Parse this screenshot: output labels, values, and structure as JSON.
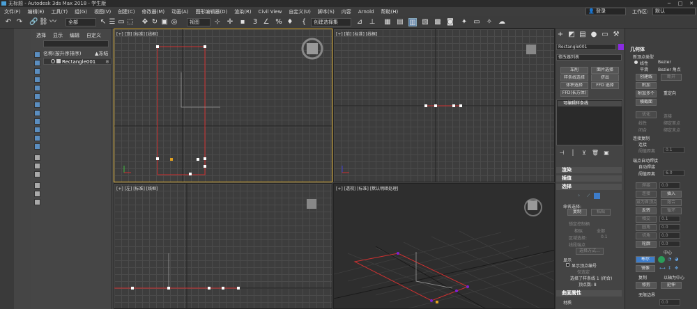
{
  "titlebar": {
    "title": "无标题 - Autodesk 3ds Max 2018 - 学生版"
  },
  "menu": [
    "文件(F)",
    "编辑(E)",
    "工具(T)",
    "组(G)",
    "视图(V)",
    "创建(C)",
    "修改器(M)",
    "动画(A)",
    "图形编辑器(D)",
    "渲染(R)",
    "Civil View",
    "自定义(U)",
    "脚本(S)",
    "内容",
    "Arnold",
    "帮助(H)"
  ],
  "login": "登录",
  "workspace": {
    "label": "工作区:",
    "value": "默认"
  },
  "toolbar": {
    "filter": "全部",
    "refcoord": "视图",
    "selset": "创建选择集"
  },
  "scene": {
    "tabs": [
      "选择",
      "显示",
      "编辑",
      "自定义"
    ],
    "col_name": "名称(按升序排序)",
    "col_freeze": "▲冻结",
    "object": "Rectangle001"
  },
  "viewports": {
    "top": "[+] [顶] [标准] [线框]",
    "front": "[+] [前] [标准] [线框]",
    "left": "[+] [左] [标准] [线框]",
    "persp": "[+] [透视] [标准] [默认明暗处理]"
  },
  "cmd": {
    "objname": "Rectangle001",
    "modlist": "修改器列表",
    "btns": [
      "车削",
      "面片选择",
      "样条线选择",
      "挤出",
      "体积选择",
      "FFD 选择",
      "FFD(长方体)"
    ],
    "stack": "可编辑样条线",
    "sections": [
      "渲染",
      "插值",
      "选择"
    ],
    "named_sel": "命名选择:",
    "copy": "复制",
    "paste": "粘贴",
    "lock_handles": "锁定控制柄",
    "similar": "相似",
    "all": "全部",
    "area_sel": "区域选择:",
    "area_val": "0.1",
    "seg_end": "线段端点",
    "sel_by": "选择方式...",
    "display": "显示",
    "show_vnum": "显示顶点编号",
    "sel_only": "仅选定",
    "status": "选择了样条线 1 (闭合)",
    "vcount": "顶点数: 8",
    "surface": "曲面属性",
    "material": "材质"
  },
  "rollout": {
    "title": "几何体",
    "newvtype": "新顶点类型",
    "types": [
      "线性",
      "Bezier",
      "平滑",
      "Bezier 角点"
    ],
    "create_line": "创建线",
    "break": "断开",
    "attach": "附加",
    "attach_multi": "附加多个",
    "reorient": "重定向",
    "cross_section": "横截面",
    "refine": "优化",
    "connect": "连接",
    "linear": "线性",
    "bind_first": "绑定首点",
    "closed": "闭合",
    "bind_last": "绑定末点",
    "connect_copy": "连接复制",
    "connect_opt": "连接",
    "threshold": "阈值距离",
    "th_val": "0.1",
    "end_weld": "端点自动焊接",
    "auto_weld": "自动焊接",
    "weld_th": "阈值距离",
    "weld_val": "6.0",
    "weld": "焊接",
    "connect2": "连接",
    "insert": "插入",
    "make_first": "设为首顶点",
    "fuse": "熔合",
    "reverse": "反转",
    "cycle": "循环",
    "cross_insert": "相交",
    "fillet": "圆角",
    "chamfer": "切角",
    "outline": "轮廓",
    "val": "0.1",
    "vals": [
      "0.0",
      "0.0",
      "0.0",
      "0.0",
      "0.0"
    ],
    "center": "中心",
    "bool": "布尔",
    "mirror": "镜像",
    "copy": "复制",
    "about_pivot": "以轴为中心",
    "trim": "修剪",
    "extend": "延伸",
    "infinite": "无限边界"
  }
}
